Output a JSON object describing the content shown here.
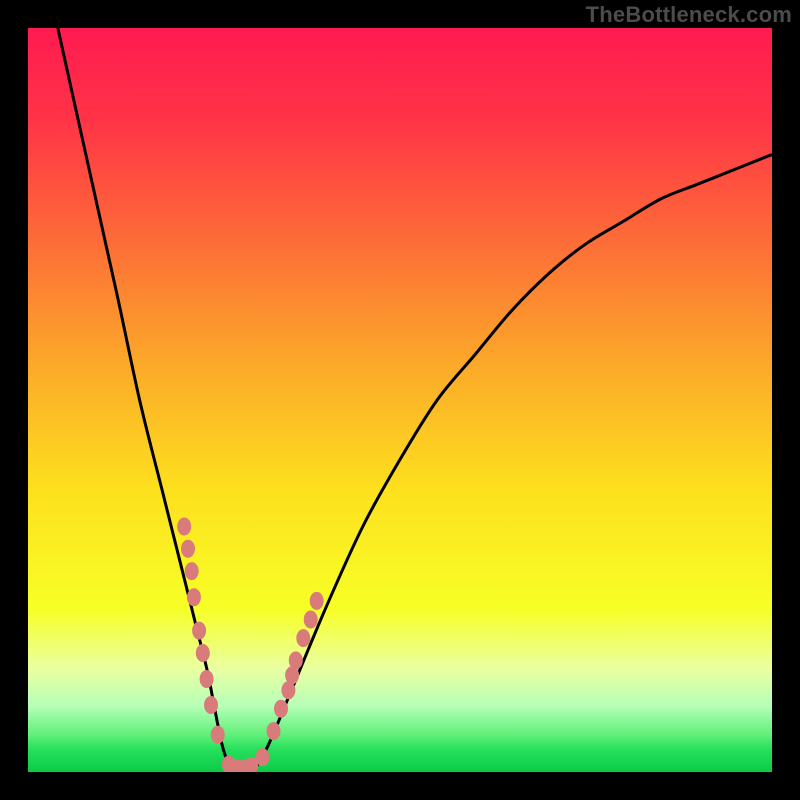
{
  "attribution": "TheBottleneck.com",
  "gradient": {
    "stops": [
      {
        "offset": 0.0,
        "color": "#ff1a50"
      },
      {
        "offset": 0.12,
        "color": "#ff3347"
      },
      {
        "offset": 0.28,
        "color": "#fd6a38"
      },
      {
        "offset": 0.45,
        "color": "#fca829"
      },
      {
        "offset": 0.62,
        "color": "#fde01e"
      },
      {
        "offset": 0.78,
        "color": "#f7ff26"
      },
      {
        "offset": 0.86,
        "color": "#eaffa0"
      },
      {
        "offset": 0.91,
        "color": "#b8ffb8"
      },
      {
        "offset": 0.95,
        "color": "#60f07a"
      },
      {
        "offset": 0.97,
        "color": "#26e05c"
      },
      {
        "offset": 1.0,
        "color": "#0acb46"
      }
    ]
  },
  "curve_color": "#000000",
  "marker_color": "#d97b7b",
  "chart_data": {
    "type": "line",
    "title": "",
    "xlabel": "",
    "ylabel": "",
    "xlim": [
      0,
      100
    ],
    "ylim": [
      0,
      100
    ],
    "series": [
      {
        "name": "bottleneck-curve",
        "x": [
          4,
          8,
          12,
          15,
          18,
          20,
          22,
          24,
          25,
          26,
          27,
          28,
          30,
          32,
          35,
          40,
          45,
          50,
          55,
          60,
          65,
          70,
          75,
          80,
          85,
          90,
          95,
          100
        ],
        "y": [
          100,
          82,
          64,
          50,
          38,
          30,
          22,
          14,
          9,
          4,
          1,
          0,
          0,
          3,
          10,
          22,
          33,
          42,
          50,
          56,
          62,
          67,
          71,
          74,
          77,
          79,
          81,
          83
        ]
      }
    ],
    "markers": {
      "name": "data-points",
      "points": [
        {
          "x": 21.0,
          "y": 33.0
        },
        {
          "x": 21.5,
          "y": 30.0
        },
        {
          "x": 22.0,
          "y": 27.0
        },
        {
          "x": 22.3,
          "y": 23.5
        },
        {
          "x": 23.0,
          "y": 19.0
        },
        {
          "x": 23.5,
          "y": 16.0
        },
        {
          "x": 24.0,
          "y": 12.5
        },
        {
          "x": 24.6,
          "y": 9.0
        },
        {
          "x": 25.5,
          "y": 5.0
        },
        {
          "x": 27.0,
          "y": 1.0
        },
        {
          "x": 28.0,
          "y": 0.5
        },
        {
          "x": 29.0,
          "y": 0.5
        },
        {
          "x": 30.0,
          "y": 0.8
        },
        {
          "x": 31.5,
          "y": 2.0
        },
        {
          "x": 33.0,
          "y": 5.5
        },
        {
          "x": 34.0,
          "y": 8.5
        },
        {
          "x": 35.0,
          "y": 11.0
        },
        {
          "x": 35.5,
          "y": 13.0
        },
        {
          "x": 36.0,
          "y": 15.0
        },
        {
          "x": 37.0,
          "y": 18.0
        },
        {
          "x": 38.0,
          "y": 20.5
        },
        {
          "x": 38.8,
          "y": 23.0
        }
      ]
    }
  }
}
